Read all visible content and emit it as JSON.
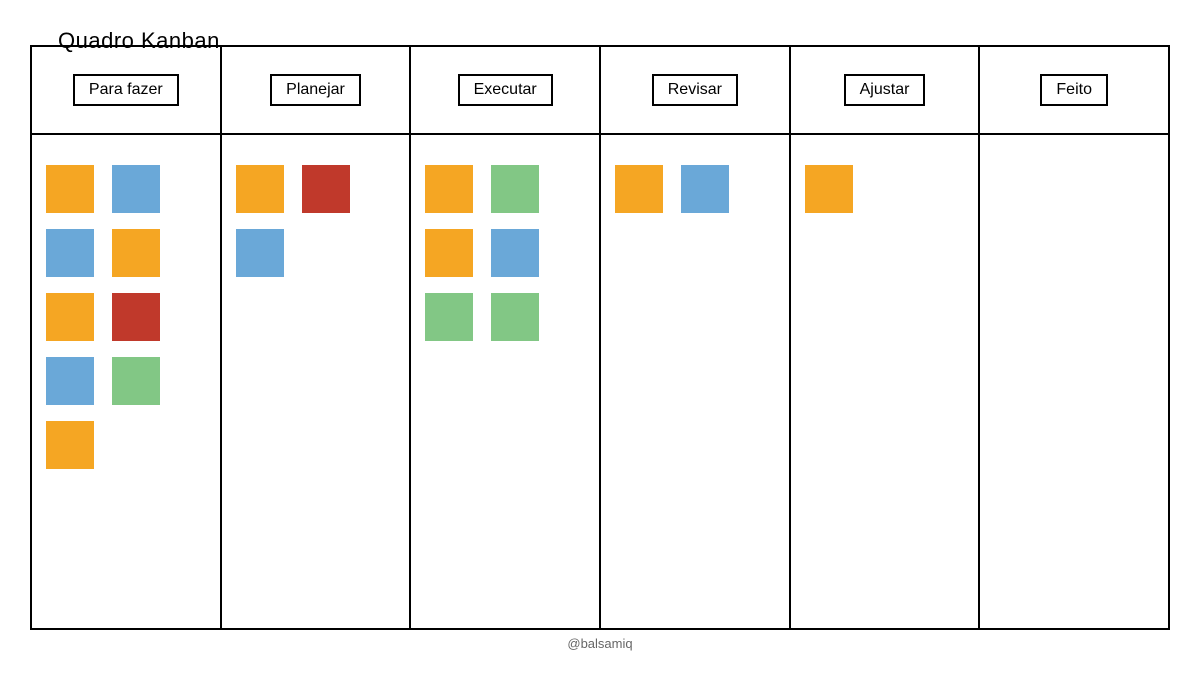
{
  "title": "Quadro Kanban",
  "credit": "@balsamiq",
  "palette": {
    "orange": "#f5a623",
    "blue": "#6aa8d8",
    "red": "#c0392b",
    "green": "#82c785"
  },
  "columns": [
    {
      "id": "todo",
      "label": "Para fazer",
      "cards": [
        [
          "orange",
          "blue"
        ],
        [
          "blue",
          "orange"
        ],
        [
          "orange",
          "red"
        ],
        [
          "blue",
          "green"
        ],
        [
          "orange"
        ]
      ]
    },
    {
      "id": "plan",
      "label": "Planejar",
      "cards": [
        [
          "orange",
          "red"
        ],
        [
          "blue"
        ]
      ]
    },
    {
      "id": "execute",
      "label": "Executar",
      "cards": [
        [
          "orange",
          "green"
        ],
        [
          "orange",
          "blue"
        ],
        [
          "green",
          "green"
        ]
      ]
    },
    {
      "id": "review",
      "label": "Revisar",
      "cards": [
        [
          "orange",
          "blue"
        ]
      ]
    },
    {
      "id": "adjust",
      "label": "Ajustar",
      "cards": [
        [
          "orange"
        ]
      ]
    },
    {
      "id": "done",
      "label": "Feito",
      "cards": []
    }
  ]
}
